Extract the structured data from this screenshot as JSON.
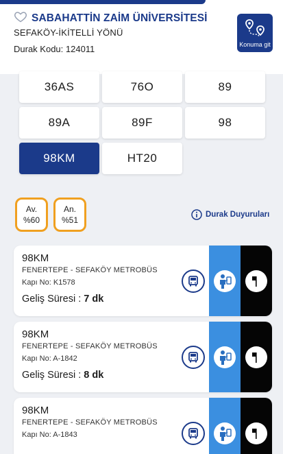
{
  "stop": {
    "name": "SABAHATTİN ZAİM ÜNİVERSİTESİ",
    "direction": "SEFAKÖY-İKİTELLİ YÖNÜ",
    "code_label": "Durak Kodu: 124011",
    "go_button_label": "Konuma git"
  },
  "lines": [
    "36AS",
    "76O",
    "89",
    "89A",
    "89F",
    "98",
    "98KM",
    "HT20"
  ],
  "selected_line": "98KM",
  "occupancy": {
    "av_label": "Av.",
    "av_value": "%60",
    "an_label": "An.",
    "an_value": "%51"
  },
  "announcements_label": "Durak Duyuruları",
  "arrivals": [
    {
      "code": "98KM",
      "route": "FENERTEPE - SEFAKÖY METROBÜS",
      "door": "Kapı No: K1578",
      "eta_label": "Geliş Süresi : ",
      "eta_value": "7 dk"
    },
    {
      "code": "98KM",
      "route": "FENERTEPE - SEFAKÖY METROBÜS",
      "door": "Kapı No: A-1842",
      "eta_label": "Geliş Süresi : ",
      "eta_value": "8 dk"
    },
    {
      "code": "98KM",
      "route": "FENERTEPE - SEFAKÖY METROBÜS",
      "door": "Kapı No: A-1843",
      "eta_label": "",
      "eta_value": ""
    }
  ],
  "icons": {
    "favorite": "heart-outline-icon",
    "location": "route-pin-icon",
    "info": "info-icon",
    "bus": "bus-icon",
    "passenger": "passenger-icon",
    "flag": "flag-icon"
  },
  "colors": {
    "brand": "#1b3a8a",
    "occupancy_border": "#f0a020",
    "panel_blue": "#3b8fe0",
    "panel_black": "#050505"
  }
}
